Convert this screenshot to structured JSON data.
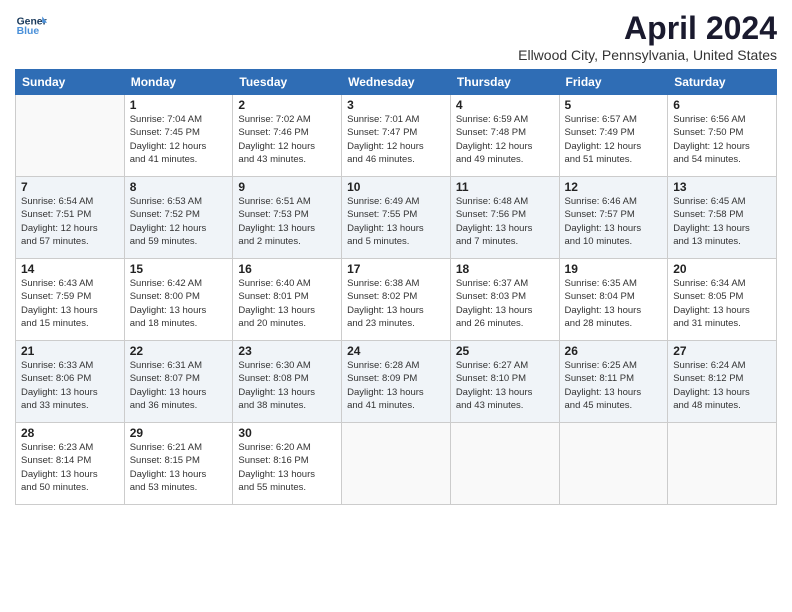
{
  "header": {
    "logo_line1": "General",
    "logo_line2": "Blue",
    "month": "April 2024",
    "location": "Ellwood City, Pennsylvania, United States"
  },
  "weekdays": [
    "Sunday",
    "Monday",
    "Tuesday",
    "Wednesday",
    "Thursday",
    "Friday",
    "Saturday"
  ],
  "weeks": [
    [
      {
        "day": "",
        "info": ""
      },
      {
        "day": "1",
        "info": "Sunrise: 7:04 AM\nSunset: 7:45 PM\nDaylight: 12 hours\nand 41 minutes."
      },
      {
        "day": "2",
        "info": "Sunrise: 7:02 AM\nSunset: 7:46 PM\nDaylight: 12 hours\nand 43 minutes."
      },
      {
        "day": "3",
        "info": "Sunrise: 7:01 AM\nSunset: 7:47 PM\nDaylight: 12 hours\nand 46 minutes."
      },
      {
        "day": "4",
        "info": "Sunrise: 6:59 AM\nSunset: 7:48 PM\nDaylight: 12 hours\nand 49 minutes."
      },
      {
        "day": "5",
        "info": "Sunrise: 6:57 AM\nSunset: 7:49 PM\nDaylight: 12 hours\nand 51 minutes."
      },
      {
        "day": "6",
        "info": "Sunrise: 6:56 AM\nSunset: 7:50 PM\nDaylight: 12 hours\nand 54 minutes."
      }
    ],
    [
      {
        "day": "7",
        "info": "Sunrise: 6:54 AM\nSunset: 7:51 PM\nDaylight: 12 hours\nand 57 minutes."
      },
      {
        "day": "8",
        "info": "Sunrise: 6:53 AM\nSunset: 7:52 PM\nDaylight: 12 hours\nand 59 minutes."
      },
      {
        "day": "9",
        "info": "Sunrise: 6:51 AM\nSunset: 7:53 PM\nDaylight: 13 hours\nand 2 minutes."
      },
      {
        "day": "10",
        "info": "Sunrise: 6:49 AM\nSunset: 7:55 PM\nDaylight: 13 hours\nand 5 minutes."
      },
      {
        "day": "11",
        "info": "Sunrise: 6:48 AM\nSunset: 7:56 PM\nDaylight: 13 hours\nand 7 minutes."
      },
      {
        "day": "12",
        "info": "Sunrise: 6:46 AM\nSunset: 7:57 PM\nDaylight: 13 hours\nand 10 minutes."
      },
      {
        "day": "13",
        "info": "Sunrise: 6:45 AM\nSunset: 7:58 PM\nDaylight: 13 hours\nand 13 minutes."
      }
    ],
    [
      {
        "day": "14",
        "info": "Sunrise: 6:43 AM\nSunset: 7:59 PM\nDaylight: 13 hours\nand 15 minutes."
      },
      {
        "day": "15",
        "info": "Sunrise: 6:42 AM\nSunset: 8:00 PM\nDaylight: 13 hours\nand 18 minutes."
      },
      {
        "day": "16",
        "info": "Sunrise: 6:40 AM\nSunset: 8:01 PM\nDaylight: 13 hours\nand 20 minutes."
      },
      {
        "day": "17",
        "info": "Sunrise: 6:38 AM\nSunset: 8:02 PM\nDaylight: 13 hours\nand 23 minutes."
      },
      {
        "day": "18",
        "info": "Sunrise: 6:37 AM\nSunset: 8:03 PM\nDaylight: 13 hours\nand 26 minutes."
      },
      {
        "day": "19",
        "info": "Sunrise: 6:35 AM\nSunset: 8:04 PM\nDaylight: 13 hours\nand 28 minutes."
      },
      {
        "day": "20",
        "info": "Sunrise: 6:34 AM\nSunset: 8:05 PM\nDaylight: 13 hours\nand 31 minutes."
      }
    ],
    [
      {
        "day": "21",
        "info": "Sunrise: 6:33 AM\nSunset: 8:06 PM\nDaylight: 13 hours\nand 33 minutes."
      },
      {
        "day": "22",
        "info": "Sunrise: 6:31 AM\nSunset: 8:07 PM\nDaylight: 13 hours\nand 36 minutes."
      },
      {
        "day": "23",
        "info": "Sunrise: 6:30 AM\nSunset: 8:08 PM\nDaylight: 13 hours\nand 38 minutes."
      },
      {
        "day": "24",
        "info": "Sunrise: 6:28 AM\nSunset: 8:09 PM\nDaylight: 13 hours\nand 41 minutes."
      },
      {
        "day": "25",
        "info": "Sunrise: 6:27 AM\nSunset: 8:10 PM\nDaylight: 13 hours\nand 43 minutes."
      },
      {
        "day": "26",
        "info": "Sunrise: 6:25 AM\nSunset: 8:11 PM\nDaylight: 13 hours\nand 45 minutes."
      },
      {
        "day": "27",
        "info": "Sunrise: 6:24 AM\nSunset: 8:12 PM\nDaylight: 13 hours\nand 48 minutes."
      }
    ],
    [
      {
        "day": "28",
        "info": "Sunrise: 6:23 AM\nSunset: 8:14 PM\nDaylight: 13 hours\nand 50 minutes."
      },
      {
        "day": "29",
        "info": "Sunrise: 6:21 AM\nSunset: 8:15 PM\nDaylight: 13 hours\nand 53 minutes."
      },
      {
        "day": "30",
        "info": "Sunrise: 6:20 AM\nSunset: 8:16 PM\nDaylight: 13 hours\nand 55 minutes."
      },
      {
        "day": "",
        "info": ""
      },
      {
        "day": "",
        "info": ""
      },
      {
        "day": "",
        "info": ""
      },
      {
        "day": "",
        "info": ""
      }
    ]
  ]
}
